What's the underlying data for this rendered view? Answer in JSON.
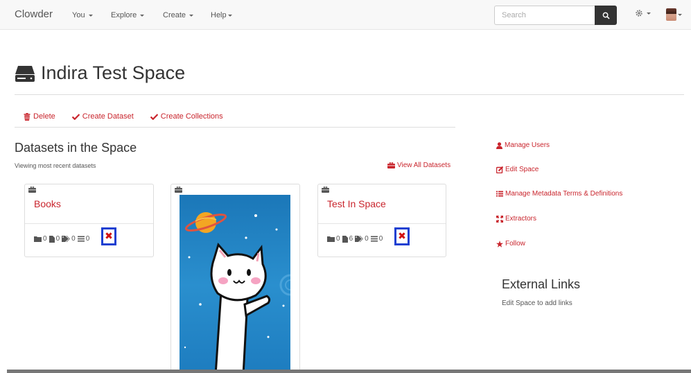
{
  "navbar": {
    "brand": "Clowder",
    "menus": [
      {
        "label": "You"
      },
      {
        "label": "Explore"
      },
      {
        "label": "Create"
      },
      {
        "label": "Help"
      }
    ],
    "search_placeholder": "Search",
    "search_icon": "magnifier-icon",
    "settings_icon": "gear-icon"
  },
  "page": {
    "title": "Indira Test Space",
    "title_icon": "hard-drive-icon"
  },
  "actions": {
    "delete": "Delete",
    "create_dataset": "Create Dataset",
    "create_collections": "Create Collections"
  },
  "datasets": {
    "heading": "Datasets in the Space",
    "subheading": "Viewing most recent datasets",
    "view_all": "View All Datasets",
    "cards": [
      {
        "title": "Books",
        "folders": "0",
        "files": "0",
        "tags": "0",
        "comments": "0"
      },
      {
        "title": "",
        "image": "cat-in-space-thumbnail"
      },
      {
        "title": "Test In Space",
        "folders": "0",
        "files": "6",
        "tags": "0",
        "comments": "0"
      }
    ],
    "remove_symbol": "✖"
  },
  "sidebar": {
    "links": [
      {
        "label": "Manage Users",
        "icon": "user-icon"
      },
      {
        "label": "Edit Space",
        "icon": "edit-icon"
      },
      {
        "label": "Manage Metadata Terms & Definitions",
        "icon": "list-icon"
      },
      {
        "label": "Extractors",
        "icon": "fullscreen-icon"
      },
      {
        "label": "Follow",
        "icon": "star-icon"
      }
    ],
    "external_links_title": "External Links",
    "external_links_sub": "Edit Space to add links"
  },
  "colors": {
    "accent": "#c9252d",
    "highlight_box": "#1c3fd1",
    "navbar_bg": "#f8f8f8"
  }
}
